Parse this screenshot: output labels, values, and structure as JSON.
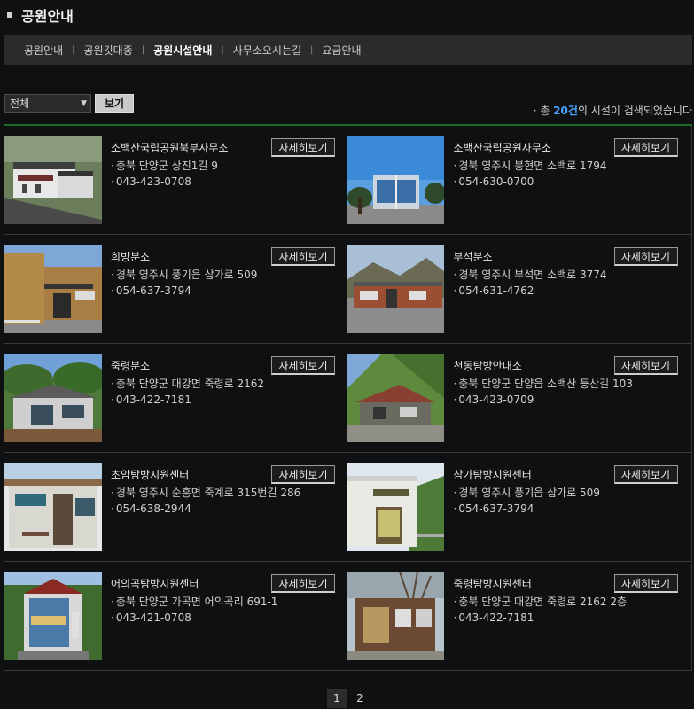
{
  "page": {
    "title": "공원안내"
  },
  "subnav": {
    "tabs": [
      {
        "label": "공원안내"
      },
      {
        "label": "공원깃대종"
      },
      {
        "label": "공원시설안내"
      },
      {
        "label": "사무소오시는길"
      },
      {
        "label": "요금안내"
      }
    ],
    "active_index": 2
  },
  "filter": {
    "selected": "전체",
    "view_button": "보기"
  },
  "results": {
    "prefix": "· 총 ",
    "count": "20건",
    "suffix": "의 시설이 검색되었습니다"
  },
  "detail_label": "자세히보기",
  "bullet": "·",
  "facilities": [
    {
      "name": "소백산국립공원북부사무소",
      "address": "충북 단양군 상진1길 9",
      "phone": "043-423-0708"
    },
    {
      "name": "소백산국립공원사무소",
      "address": "경북 영주시 봉현면 소백로 1794",
      "phone": "054-630-0700"
    },
    {
      "name": "희방분소",
      "address": "경북 영주시 풍기읍 삼가로 509",
      "phone": "054-637-3794"
    },
    {
      "name": "부석분소",
      "address": "경북 영주시 부석면 소백로 3774",
      "phone": "054-631-4762"
    },
    {
      "name": "죽령분소",
      "address": "충북 단양군 대강면 죽령로 2162",
      "phone": "043-422-7181"
    },
    {
      "name": "천동탐방안내소",
      "address": "충북 단양군 단양읍 소백산 등산길 103",
      "phone": "043-423-0709"
    },
    {
      "name": "초암탐방지원센터",
      "address": "경북 영주시 순흥면 죽계로 315번길 286",
      "phone": "054-638-2944"
    },
    {
      "name": "삼가탐방지원센터",
      "address": "경북 영주시 풍기읍 삼가로 509",
      "phone": "054-637-3794"
    },
    {
      "name": "어의곡탐방지원센터",
      "address": "충북 단양군 가곡면 어의곡리 691-1",
      "phone": "043-421-0708"
    },
    {
      "name": "죽령탐방지원센터",
      "address": "충북 단양군 대강면 죽령로 2162 2층",
      "phone": "043-422-7181"
    }
  ],
  "pagination": {
    "pages": [
      "1",
      "2"
    ],
    "current": "1"
  }
}
